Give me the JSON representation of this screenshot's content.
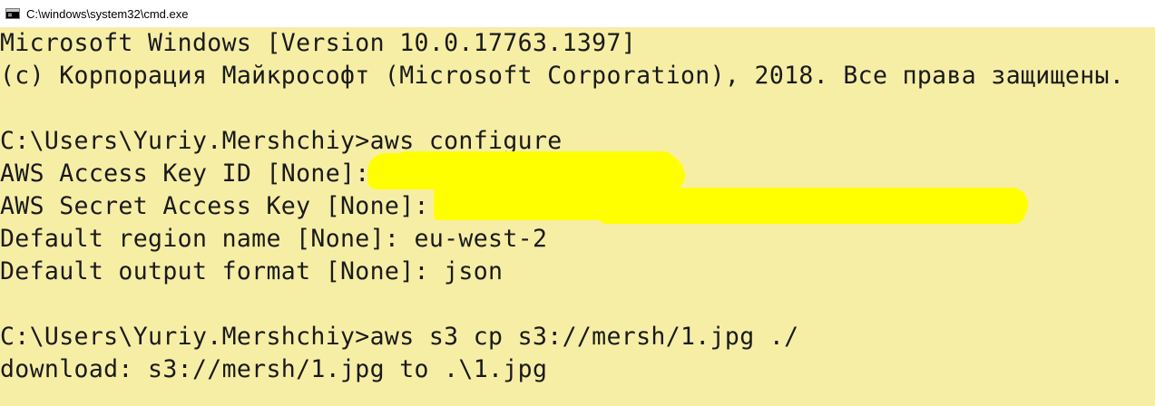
{
  "window": {
    "title": "C:\\windows\\system32\\cmd.exe",
    "icon": "cmd-console-icon"
  },
  "colors": {
    "background": "#f7eea6",
    "text": "#1a1a1a",
    "redaction": "#ffff00",
    "titlebar": "#ffffff"
  },
  "console": {
    "lines": [
      "Microsoft Windows [Version 10.0.17763.1397]",
      "(c) Корпорация Майкрософт (Microsoft Corporation), 2018. Все права защищены.",
      "",
      "C:\\Users\\Yuriy.Mershchiy>aws configure",
      "AWS Access Key ID [None]:",
      "AWS Secret Access Key [None]:",
      "Default region name [None]: eu-west-2",
      "Default output format [None]: json",
      "",
      "C:\\Users\\Yuriy.Mershchiy>aws s3 cp s3://mersh/1.jpg ./",
      "download: s3://mersh/1.jpg to .\\1.jpg"
    ]
  }
}
